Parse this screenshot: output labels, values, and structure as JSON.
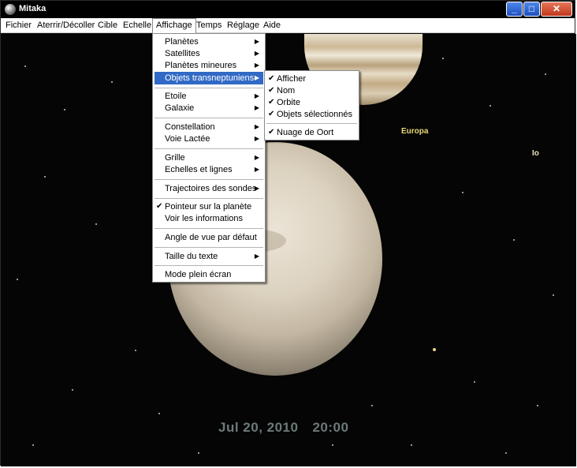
{
  "window": {
    "title": "Mitaka"
  },
  "title_buttons": {
    "minimize": "_",
    "maximize": "□",
    "close": "✕"
  },
  "menubar": {
    "items": [
      "Fichier",
      "Aterrir/Décoller",
      "Cible",
      "Echelle",
      "Affichage",
      "Temps",
      "Réglage",
      "Aide"
    ],
    "active": "Affichage"
  },
  "affichage_menu": {
    "items": [
      {
        "label": "Planètes",
        "submenu": true
      },
      {
        "label": "Satellites",
        "submenu": true
      },
      {
        "label": "Planètes mineures",
        "submenu": true
      },
      {
        "label": "Objets transneptuniens",
        "submenu": true,
        "highlighted": true
      },
      {
        "label": "Etoile",
        "submenu": true
      },
      {
        "label": "Galaxie",
        "submenu": true
      },
      {
        "label": "Constellation",
        "submenu": true
      },
      {
        "label": "Voie Lactée",
        "submenu": true
      },
      {
        "label": "Grille",
        "submenu": true
      },
      {
        "label": "Echelles et lignes",
        "submenu": true
      },
      {
        "label": "Trajectoires des sondes",
        "submenu": true
      },
      {
        "label": "Pointeur sur la planète",
        "checked": true
      },
      {
        "label": "Voir les informations"
      },
      {
        "label": "Angle de vue par défaut"
      },
      {
        "label": "Taille du texte",
        "submenu": true
      },
      {
        "label": "Mode plein écran"
      }
    ]
  },
  "tno_submenu": {
    "items": [
      {
        "label": "Afficher",
        "checked": true
      },
      {
        "label": "Nom",
        "checked": true
      },
      {
        "label": "Orbite",
        "checked": true
      },
      {
        "label": "Objets sélectionnés",
        "checked": true
      },
      {
        "label": "Nuage de Oort",
        "checked": true
      }
    ]
  },
  "scene": {
    "labels": {
      "europa": "Europa",
      "io": "Io"
    },
    "date": "Jul 20, 2010",
    "time": "20:00"
  },
  "glyphs": {
    "arrow": "▶",
    "check": "✔"
  },
  "colors": {
    "highlight": "#316ac5",
    "europa_label": "#e8d873",
    "datetime": "#6d7a7a",
    "space": "#050505"
  }
}
